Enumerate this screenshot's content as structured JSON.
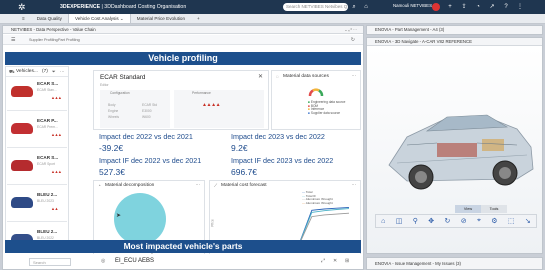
{
  "topbar": {
    "brand_bold": "3DEXPERIENCE",
    "brand_rest": " | 3DDashboard Costing Organisation",
    "search_placeholder": "Search NETVIBES Netvibes Q",
    "user": "Namouli NETVIBES"
  },
  "tabs": [
    "Data Quality",
    "Vehicle Cost Analysis",
    "Material Price Evolution",
    "+"
  ],
  "left_window_title": "NETVIBES - Data Perspective - Value Chain",
  "crumb": {
    "a": "Supplier Profiling",
    "b": "Part Profiling"
  },
  "vp": {
    "title": "Vehicle profiling",
    "list_header": "Vehicles...",
    "list_count": "(7)",
    "vehicles": [
      {
        "name": "ECAR S...",
        "sub": "ECAR Stan...",
        "warn": "▲▲▲",
        "color": "#c0302c"
      },
      {
        "name": "ECAR P...",
        "sub": "ECAR Prem...",
        "warn": "▲▲▲",
        "color": "#c22f32"
      },
      {
        "name": "ECAR S...",
        "sub": "ECAR Sport",
        "warn": "▲▲▲",
        "color": "#b52b2e"
      },
      {
        "name": "BLEU 2...",
        "sub": "BLEU 2023",
        "warn": "▲▲",
        "color": "#2e4a86"
      },
      {
        "name": "BLEU 2...",
        "sub": "BLEU 2022",
        "warn": "▲▲",
        "color": "#344f8a"
      }
    ],
    "detail": {
      "name": "ECAR Standard",
      "close": "✕",
      "sub": "Editor",
      "config_label": "Configuration",
      "perf_label": "Performance",
      "rows": [
        {
          "k": "Body",
          "v": "ECAR Std"
        },
        {
          "k": "Engine",
          "v": "E3000"
        },
        {
          "k": "Wheels",
          "v": "W600"
        }
      ],
      "perf_warn": "▲▲▲▲"
    },
    "mds": {
      "title": "Material data sources",
      "legend": [
        "Engineering data source",
        "BOM",
        "Inference",
        "Supplier data source"
      ]
    },
    "kpis": [
      {
        "title": "Impact dec 2022 vs dec 2021",
        "value": "-39.2€"
      },
      {
        "title": "Impact dec 2023 vs dec 2022",
        "value": "9.2€"
      },
      {
        "title": "Impact IF dec 2022 vs dec 2021",
        "value": "527.3€"
      },
      {
        "title": "Impact IF dec 2023 vs dec 2022",
        "value": "696.7€"
      }
    ],
    "decomp": {
      "title": "Material decomposition",
      "legend": "Aluminium Wrought"
    },
    "forecast": {
      "title": "Material cost forecast",
      "legend": [
        "Total",
        "Total IF",
        "Aluminium Wrought",
        "Aluminium Wrought"
      ],
      "ylabel": "Price",
      "x_ticks": [
        "2022",
        "2023"
      ]
    },
    "impacted_title": "Most impacted vehicle's parts",
    "bottom": {
      "search": "Search",
      "item": "EI_ECU AEBS"
    }
  },
  "right": {
    "top_title": "ENOVIA - Part Management - A4 (3)",
    "viewer_title": "ENOVIA - 3D Navigate - A-CAR V82 REFERENCE",
    "view_tabs": [
      "View",
      "Tools"
    ],
    "bottom_title": "ENOVIA - Issue Management - My Issues (3)"
  },
  "colors": {
    "topbar": "#1f3650",
    "band": "#1d4f8c",
    "kpi": "#1e4b8c",
    "pie": "#7fd3de",
    "warn": "#c83228"
  },
  "chart_data": [
    {
      "type": "pie",
      "title": "Material decomposition",
      "categories": [
        "Aluminium Wrought"
      ],
      "values": [
        100
      ]
    },
    {
      "type": "line",
      "title": "Material cost forecast",
      "ylabel": "Price",
      "x": [
        "2022",
        "",
        "",
        "",
        "",
        "",
        "",
        "",
        "",
        "",
        "2023"
      ],
      "series": [
        {
          "name": "Total",
          "values": [
            6,
            6,
            6,
            6,
            6,
            6,
            7,
            85,
            88,
            90,
            92
          ]
        },
        {
          "name": "Total IF",
          "values": [
            5,
            5,
            5,
            5,
            5,
            5,
            6,
            80,
            84,
            87,
            89
          ]
        },
        {
          "name": "Aluminium Wrought",
          "values": [
            4,
            4,
            4,
            4,
            4,
            4,
            5,
            70,
            74,
            76,
            78
          ]
        }
      ]
    }
  ]
}
